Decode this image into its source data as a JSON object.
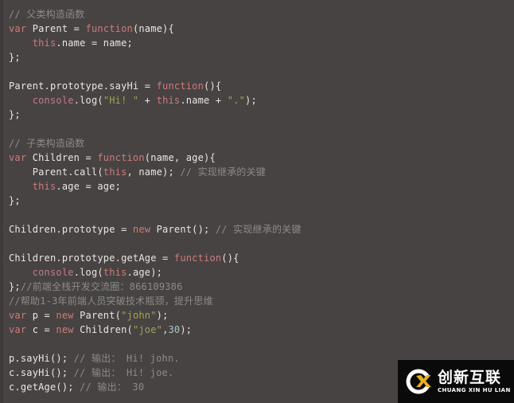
{
  "editor": {
    "background_color": "#474342",
    "gutter_color": "#3f3b3a",
    "font_size_px": 12,
    "line_height_px": 18,
    "language": "javascript",
    "colors": {
      "keyword": "#cc7b7b",
      "identifier": "#e8e6e3",
      "string": "#a5a158",
      "comment": "#8b8b87",
      "console": "#c27b8a",
      "number": "#a9c6c4"
    }
  },
  "code_lines": [
    {
      "n": 1,
      "tokens": [
        {
          "t": "// 父类构造函数",
          "c": "com"
        }
      ]
    },
    {
      "n": 2,
      "tokens": [
        {
          "t": "var ",
          "c": "kw"
        },
        {
          "t": "Parent = ",
          "c": "ident"
        },
        {
          "t": "function",
          "c": "kw"
        },
        {
          "t": "(name){",
          "c": "ident"
        }
      ]
    },
    {
      "n": 3,
      "tokens": [
        {
          "t": "    ",
          "c": "ident"
        },
        {
          "t": "this",
          "c": "kw"
        },
        {
          "t": ".name = name;",
          "c": "ident"
        }
      ]
    },
    {
      "n": 4,
      "tokens": [
        {
          "t": "};",
          "c": "ident"
        }
      ]
    },
    {
      "n": 5,
      "tokens": [
        {
          "t": "",
          "c": "ident"
        }
      ]
    },
    {
      "n": 6,
      "tokens": [
        {
          "t": "Parent.prototype.sayHi = ",
          "c": "ident"
        },
        {
          "t": "function",
          "c": "kw"
        },
        {
          "t": "(){",
          "c": "ident"
        }
      ]
    },
    {
      "n": 7,
      "tokens": [
        {
          "t": "    ",
          "c": "ident"
        },
        {
          "t": "console",
          "c": "cons"
        },
        {
          "t": ".log(",
          "c": "ident"
        },
        {
          "t": "\"Hi! \"",
          "c": "str"
        },
        {
          "t": " + ",
          "c": "ident"
        },
        {
          "t": "this",
          "c": "kw"
        },
        {
          "t": ".name + ",
          "c": "ident"
        },
        {
          "t": "\".\"",
          "c": "str"
        },
        {
          "t": ");",
          "c": "ident"
        }
      ]
    },
    {
      "n": 8,
      "tokens": [
        {
          "t": "};",
          "c": "ident"
        }
      ]
    },
    {
      "n": 9,
      "tokens": [
        {
          "t": "",
          "c": "ident"
        }
      ]
    },
    {
      "n": 10,
      "tokens": [
        {
          "t": "// 子类构造函数",
          "c": "com"
        }
      ]
    },
    {
      "n": 11,
      "tokens": [
        {
          "t": "var ",
          "c": "kw"
        },
        {
          "t": "Children = ",
          "c": "ident"
        },
        {
          "t": "function",
          "c": "kw"
        },
        {
          "t": "(name, age){",
          "c": "ident"
        }
      ]
    },
    {
      "n": 12,
      "tokens": [
        {
          "t": "    Parent.call(",
          "c": "ident"
        },
        {
          "t": "this",
          "c": "kw"
        },
        {
          "t": ", name); ",
          "c": "ident"
        },
        {
          "t": "// 实现继承的关键",
          "c": "com"
        }
      ]
    },
    {
      "n": 13,
      "tokens": [
        {
          "t": "    ",
          "c": "ident"
        },
        {
          "t": "this",
          "c": "kw"
        },
        {
          "t": ".age = age;",
          "c": "ident"
        }
      ]
    },
    {
      "n": 14,
      "tokens": [
        {
          "t": "};",
          "c": "ident"
        }
      ]
    },
    {
      "n": 15,
      "tokens": [
        {
          "t": "",
          "c": "ident"
        }
      ]
    },
    {
      "n": 16,
      "tokens": [
        {
          "t": "Children.prototype = ",
          "c": "ident"
        },
        {
          "t": "new ",
          "c": "kw"
        },
        {
          "t": "Parent(); ",
          "c": "ident"
        },
        {
          "t": "// 实现继承的关键",
          "c": "com"
        }
      ]
    },
    {
      "n": 17,
      "tokens": [
        {
          "t": "",
          "c": "ident"
        }
      ]
    },
    {
      "n": 18,
      "tokens": [
        {
          "t": "Children.prototype.getAge = ",
          "c": "ident"
        },
        {
          "t": "function",
          "c": "kw"
        },
        {
          "t": "(){",
          "c": "ident"
        }
      ]
    },
    {
      "n": 19,
      "tokens": [
        {
          "t": "    ",
          "c": "ident"
        },
        {
          "t": "console",
          "c": "cons"
        },
        {
          "t": ".log(",
          "c": "ident"
        },
        {
          "t": "this",
          "c": "kw"
        },
        {
          "t": ".age);",
          "c": "ident"
        }
      ]
    },
    {
      "n": 20,
      "tokens": [
        {
          "t": "};",
          "c": "ident"
        },
        {
          "t": "//前端全栈开发交流圈：866109386",
          "c": "com"
        }
      ]
    },
    {
      "n": 21,
      "tokens": [
        {
          "t": "//帮助1-3年前端人员突破技术瓶颈，提升思维",
          "c": "com"
        }
      ]
    },
    {
      "n": 22,
      "tokens": [
        {
          "t": "var ",
          "c": "kw"
        },
        {
          "t": "p = ",
          "c": "ident"
        },
        {
          "t": "new ",
          "c": "kw"
        },
        {
          "t": "Parent(",
          "c": "ident"
        },
        {
          "t": "\"john\"",
          "c": "str"
        },
        {
          "t": ");",
          "c": "ident"
        }
      ]
    },
    {
      "n": 23,
      "tokens": [
        {
          "t": "var ",
          "c": "kw"
        },
        {
          "t": "c = ",
          "c": "ident"
        },
        {
          "t": "new ",
          "c": "kw"
        },
        {
          "t": "Children(",
          "c": "ident"
        },
        {
          "t": "\"joe\"",
          "c": "str"
        },
        {
          "t": ",",
          "c": "ident"
        },
        {
          "t": "30",
          "c": "num"
        },
        {
          "t": ");",
          "c": "ident"
        }
      ]
    },
    {
      "n": 24,
      "tokens": [
        {
          "t": "",
          "c": "ident"
        }
      ]
    },
    {
      "n": 25,
      "tokens": [
        {
          "t": "p.sayHi(); ",
          "c": "ident"
        },
        {
          "t": "// 输出： Hi! john.",
          "c": "com"
        }
      ]
    },
    {
      "n": 26,
      "tokens": [
        {
          "t": "c.sayHi(); ",
          "c": "ident"
        },
        {
          "t": "// 输出： Hi! joe.",
          "c": "com"
        }
      ]
    },
    {
      "n": 27,
      "tokens": [
        {
          "t": "c.getAge(); ",
          "c": "ident"
        },
        {
          "t": "// 输出： 30",
          "c": "com"
        }
      ]
    }
  ],
  "watermark": {
    "chinese_name": "创新互联",
    "pinyin": "CHUANG XIN HU LIAN",
    "mark_letter": "C",
    "mark_accent": "X",
    "background_color": "#0a0a0a",
    "accent_color": "#e8b020",
    "text_color": "#ffffff"
  }
}
